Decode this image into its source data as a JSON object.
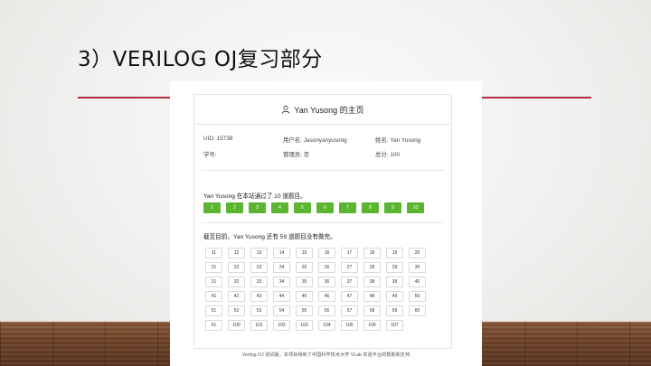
{
  "slide": {
    "title": "3）VERILOG OJ复习部分"
  },
  "page": {
    "header_title": "Yan Yusong 的主页",
    "info": {
      "uid": "UID:  15738",
      "username": "用户名:  Jasonyanyusong",
      "name": "姓名:  Yan Yusong",
      "student_id": "学号:",
      "admin": "管理员:  否",
      "total": "总分:  100"
    },
    "passed_text": "Yan Yusong 在本站通过了 10 道题目。",
    "passed": [
      "1",
      "2",
      "3",
      "4",
      "5",
      "6",
      "7",
      "8",
      "9",
      "10"
    ],
    "todo_text": "截至目前，Yan Yusong 还有 59 道题目没有做完。",
    "todo": [
      "11",
      "12",
      "13",
      "14",
      "15",
      "16",
      "17",
      "18",
      "19",
      "20",
      "21",
      "22",
      "23",
      "24",
      "25",
      "26",
      "27",
      "28",
      "29",
      "30",
      "31",
      "32",
      "33",
      "34",
      "35",
      "36",
      "37",
      "38",
      "39",
      "40",
      "41",
      "42",
      "43",
      "44",
      "45",
      "46",
      "47",
      "48",
      "49",
      "50",
      "51",
      "52",
      "53",
      "54",
      "55",
      "56",
      "57",
      "58",
      "59",
      "60",
      "61",
      "100",
      "101",
      "102",
      "103",
      "104",
      "105",
      "106",
      "107"
    ],
    "footer": "Verilog OJ 测试版，本项目得到了中国科学技术大学 VLab 实验平台的帮助和支持"
  },
  "colors": {
    "accent_rule": "#b02a3f",
    "passed_green": "#5cb531"
  }
}
